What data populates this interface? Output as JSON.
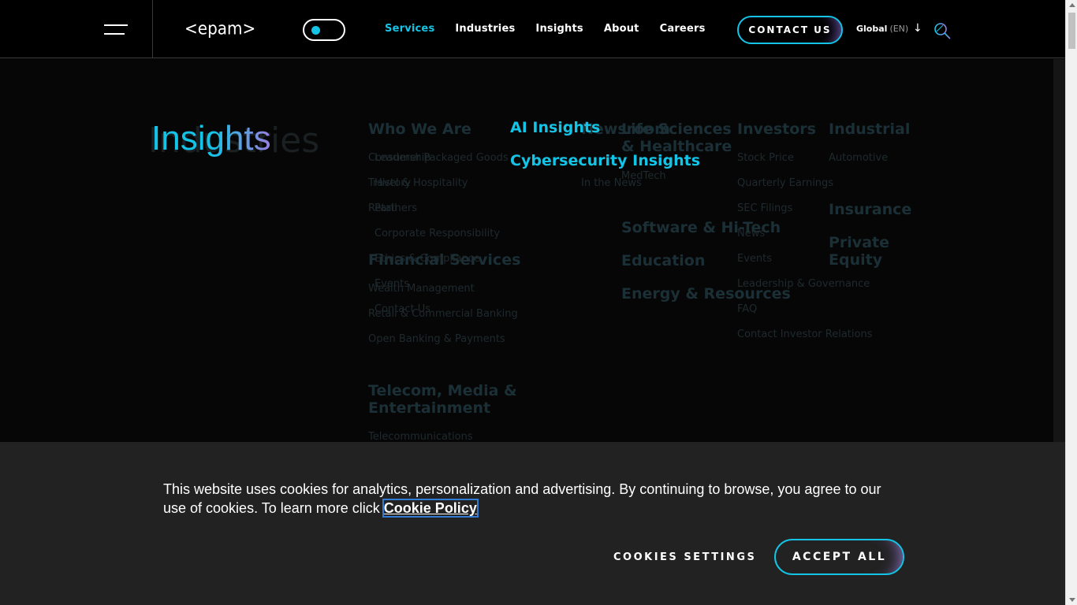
{
  "header": {
    "logo": "<epam>",
    "nav": [
      "Services",
      "Industries",
      "Insights",
      "About",
      "Careers"
    ],
    "contact_label": "CONTACT US",
    "global_label": "Global",
    "lang_label": "(EN)"
  },
  "mega_menu": {
    "title": "Insights",
    "links": [
      "AI Insights",
      "Cybersecurity Insights"
    ],
    "ghost_title": "Industries",
    "ghost_headings": [
      "Who We Are",
      "Newsroom",
      "Life Sciences & Healthcare",
      "Investors",
      "Industrial",
      "Insurance",
      "Private Equity",
      "Software & Hi-Tech",
      "Education",
      "Energy & Resources",
      "Financial Services",
      "Telecom, Media & Entertainment"
    ],
    "ghost_items": [
      "Consumer Packaged Goods",
      "Leadership",
      "Travel & Hospitality",
      "History",
      "Retail",
      "Partners",
      "Corporate Responsibility",
      "Ethics & Compliance",
      "Events",
      "Contact Us",
      "Wealth Management",
      "Retail & Commercial Banking",
      "Open Banking & Payments",
      "Telecommunications",
      "In the News",
      "MedTech",
      "Stock Price",
      "Quarterly Earnings",
      "SEC Filings",
      "News",
      "Events",
      "Leadership & Governance",
      "FAQ",
      "Contact Investor Relations",
      "Automotive"
    ]
  },
  "cookie": {
    "text": "This website uses cookies for analytics, personalization and advertising. By continuing to browse, you agree to our use of cookies. To learn more click ",
    "link": "Cookie Policy",
    "settings": "COOKIES SETTINGS",
    "accept": "ACCEPT ALL"
  },
  "colors": {
    "accent": "#14c4e6",
    "accent2": "#9b7ee0",
    "bg": "#060606",
    "banner": "#222222"
  }
}
